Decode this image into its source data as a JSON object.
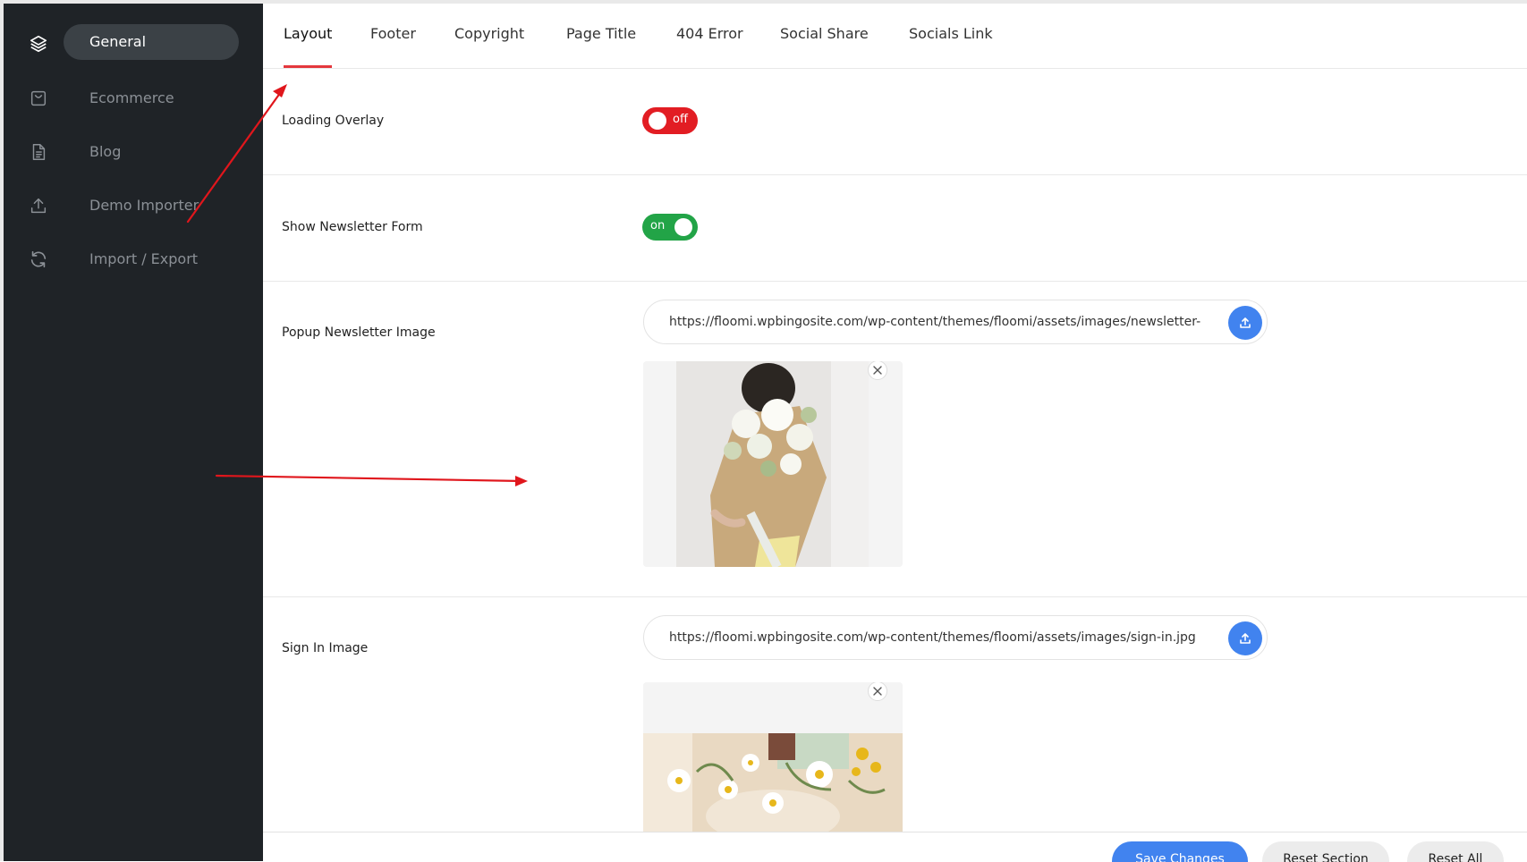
{
  "sidebar": {
    "items": [
      {
        "label": "General",
        "icon": "layers-icon",
        "active": true
      },
      {
        "label": "Ecommerce",
        "icon": "shopping-bag-icon",
        "active": false
      },
      {
        "label": "Blog",
        "icon": "document-icon",
        "active": false
      },
      {
        "label": "Demo Importer",
        "icon": "upload-icon",
        "active": false
      },
      {
        "label": "Import / Export",
        "icon": "sync-icon",
        "active": false
      }
    ]
  },
  "tabs": [
    {
      "label": "Layout",
      "active": true
    },
    {
      "label": "Footer",
      "active": false
    },
    {
      "label": "Copyright",
      "active": false
    },
    {
      "label": "Page Title",
      "active": false
    },
    {
      "label": "404 Error",
      "active": false
    },
    {
      "label": "Social Share",
      "active": false
    },
    {
      "label": "Socials Link",
      "active": false
    }
  ],
  "settings": {
    "loading_overlay": {
      "label": "Loading Overlay",
      "state": "off"
    },
    "newsletter_form": {
      "label": "Show Newsletter Form",
      "state": "on"
    },
    "popup_image": {
      "label": "Popup Newsletter Image",
      "url": "https://floomi.wpbingosite.com/wp-content/themes/floomi/assets/images/newsletter-"
    },
    "signin_image": {
      "label": "Sign In Image",
      "url": "https://floomi.wpbingosite.com/wp-content/themes/floomi/assets/images/sign-in.jpg"
    }
  },
  "footer": {
    "save_label": "Save Changes",
    "reset_section_label": "Reset Section",
    "reset_all_label": "Reset All"
  },
  "colors": {
    "sidebar_bg": "#1f2327",
    "accent_red": "#e21d23",
    "toggle_on": "#22a447",
    "primary_blue": "#4183ef",
    "annotation_arrow": "#e0161c"
  }
}
